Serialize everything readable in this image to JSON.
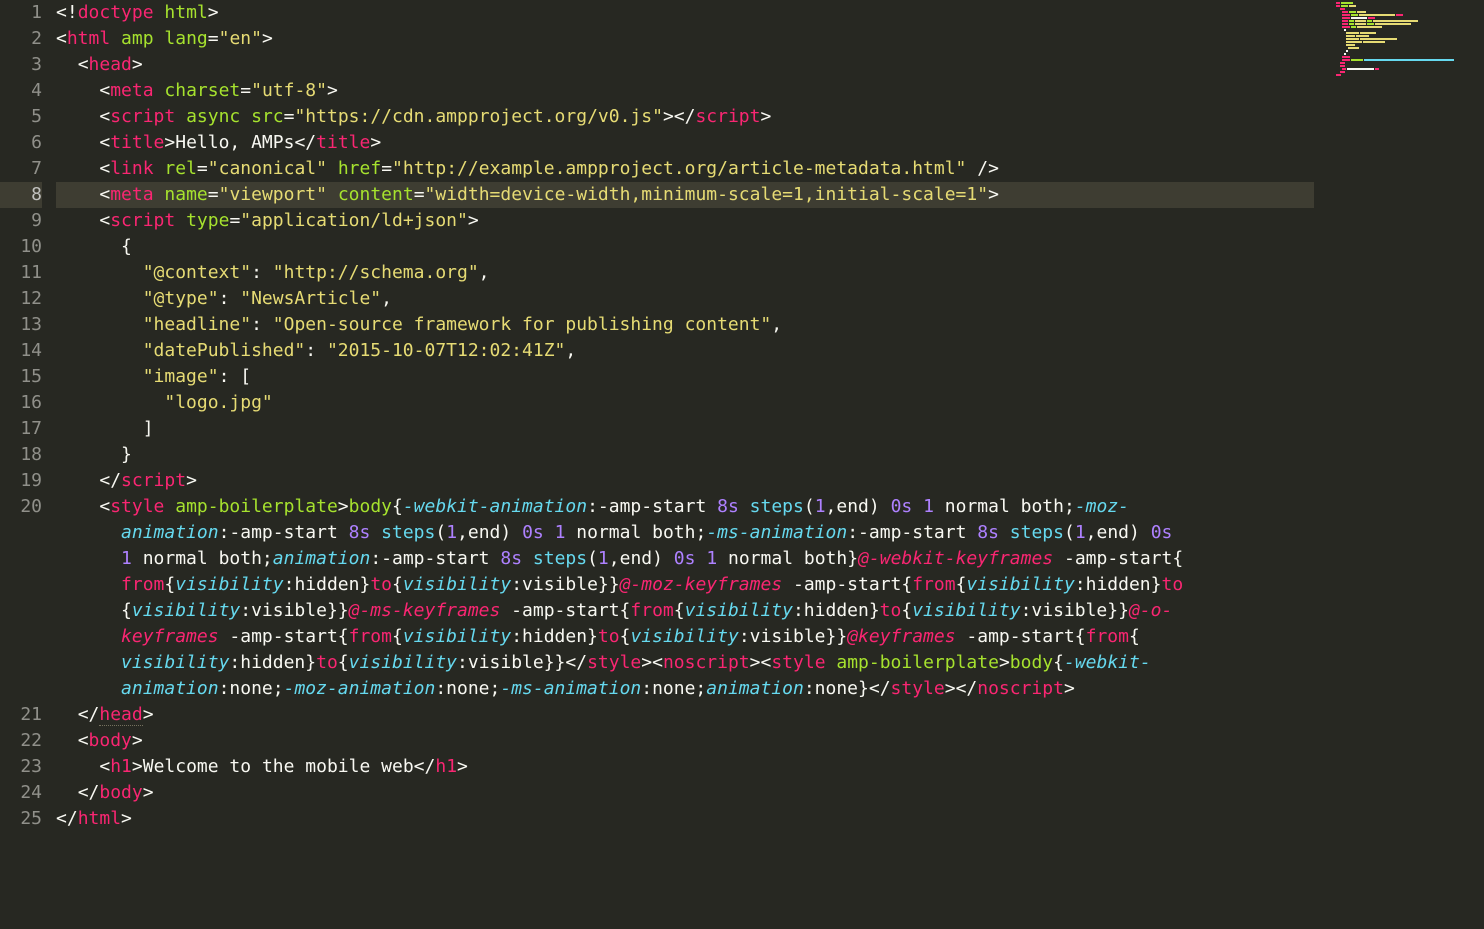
{
  "language": "html",
  "theme": "monokai",
  "current_line_number": 8,
  "line_numbers": [
    "1",
    "2",
    "3",
    "4",
    "5",
    "6",
    "7",
    "8",
    "9",
    "10",
    "11",
    "12",
    "13",
    "14",
    "15",
    "16",
    "17",
    "18",
    "19",
    "20",
    "21",
    "22",
    "23",
    "24",
    "25"
  ],
  "lines": {
    "1": {
      "indent": "",
      "tokens": [
        [
          "bracket",
          "<!"
        ],
        [
          "doctype",
          "doctype"
        ],
        [
          "txt",
          " "
        ],
        [
          "attr",
          "html"
        ],
        [
          "bracket",
          ">"
        ]
      ]
    },
    "2": {
      "indent": "",
      "tokens": [
        [
          "bracket",
          "<"
        ],
        [
          "tag",
          "html"
        ],
        [
          "txt",
          " "
        ],
        [
          "attr",
          "amp"
        ],
        [
          "txt",
          " "
        ],
        [
          "attr",
          "lang"
        ],
        [
          "txt",
          "="
        ],
        [
          "str",
          "\"en\""
        ],
        [
          "bracket",
          ">"
        ]
      ]
    },
    "3": {
      "indent": "  ",
      "tokens": [
        [
          "bracket",
          "<"
        ],
        [
          "tag",
          "head"
        ],
        [
          "bracket",
          ">"
        ]
      ]
    },
    "4": {
      "indent": "    ",
      "tokens": [
        [
          "bracket",
          "<"
        ],
        [
          "tag",
          "meta"
        ],
        [
          "txt",
          " "
        ],
        [
          "attr",
          "charset"
        ],
        [
          "txt",
          "="
        ],
        [
          "str",
          "\"utf-8\""
        ],
        [
          "bracket",
          ">"
        ]
      ]
    },
    "5": {
      "indent": "    ",
      "tokens": [
        [
          "bracket",
          "<"
        ],
        [
          "tag",
          "script"
        ],
        [
          "txt",
          " "
        ],
        [
          "attr",
          "async"
        ],
        [
          "txt",
          " "
        ],
        [
          "attr",
          "src"
        ],
        [
          "txt",
          "="
        ],
        [
          "str",
          "\"https://cdn.ampproject.org/v0.js\""
        ],
        [
          "bracket",
          "></"
        ],
        [
          "tag",
          "script"
        ],
        [
          "bracket",
          ">"
        ]
      ]
    },
    "6": {
      "indent": "    ",
      "tokens": [
        [
          "bracket",
          "<"
        ],
        [
          "tag",
          "title"
        ],
        [
          "bracket",
          ">"
        ],
        [
          "txt",
          "Hello, AMPs"
        ],
        [
          "bracket",
          "</"
        ],
        [
          "tag",
          "title"
        ],
        [
          "bracket",
          ">"
        ]
      ]
    },
    "7": {
      "indent": "    ",
      "tokens": [
        [
          "bracket",
          "<"
        ],
        [
          "tag",
          "link"
        ],
        [
          "txt",
          " "
        ],
        [
          "attr",
          "rel"
        ],
        [
          "txt",
          "="
        ],
        [
          "str",
          "\"canonical\""
        ],
        [
          "txt",
          " "
        ],
        [
          "attr",
          "href"
        ],
        [
          "txt",
          "="
        ],
        [
          "str",
          "\"http://example.ampproject.org/article-metadata.html\""
        ],
        [
          "txt",
          " "
        ],
        [
          "bracket",
          "/>"
        ]
      ]
    },
    "8": {
      "indent": "    ",
      "tokens": [
        [
          "bracket",
          "<"
        ],
        [
          "tag",
          "meta"
        ],
        [
          "txt",
          " "
        ],
        [
          "attr",
          "name"
        ],
        [
          "txt",
          "="
        ],
        [
          "str",
          "\"viewport\""
        ],
        [
          "txt",
          " "
        ],
        [
          "attr",
          "content"
        ],
        [
          "txt",
          "="
        ],
        [
          "str",
          "\"width=device-width,minimum-scale=1,initial-scale=1\""
        ],
        [
          "bracket",
          ">"
        ]
      ]
    },
    "9": {
      "indent": "    ",
      "tokens": [
        [
          "bracket",
          "<"
        ],
        [
          "tag",
          "script"
        ],
        [
          "txt",
          " "
        ],
        [
          "attr",
          "type"
        ],
        [
          "txt",
          "="
        ],
        [
          "str",
          "\"application/ld+json\""
        ],
        [
          "bracket",
          ">"
        ]
      ]
    },
    "10": {
      "indent": "      ",
      "tokens": [
        [
          "txt",
          "{"
        ]
      ]
    },
    "11": {
      "indent": "        ",
      "tokens": [
        [
          "str",
          "\"@context\""
        ],
        [
          "txt",
          ": "
        ],
        [
          "str",
          "\"http://schema.org\""
        ],
        [
          "txt",
          ","
        ]
      ]
    },
    "12": {
      "indent": "        ",
      "tokens": [
        [
          "str",
          "\"@type\""
        ],
        [
          "txt",
          ": "
        ],
        [
          "str",
          "\"NewsArticle\""
        ],
        [
          "txt",
          ","
        ]
      ]
    },
    "13": {
      "indent": "        ",
      "tokens": [
        [
          "str",
          "\"headline\""
        ],
        [
          "txt",
          ": "
        ],
        [
          "str",
          "\"Open-source framework for publishing content\""
        ],
        [
          "txt",
          ","
        ]
      ]
    },
    "14": {
      "indent": "        ",
      "tokens": [
        [
          "str",
          "\"datePublished\""
        ],
        [
          "txt",
          ": "
        ],
        [
          "str",
          "\"2015-10-07T12:02:41Z\""
        ],
        [
          "txt",
          ","
        ]
      ]
    },
    "15": {
      "indent": "        ",
      "tokens": [
        [
          "str",
          "\"image\""
        ],
        [
          "txt",
          ": ["
        ]
      ]
    },
    "16": {
      "indent": "          ",
      "tokens": [
        [
          "str",
          "\"logo.jpg\""
        ]
      ]
    },
    "17": {
      "indent": "        ",
      "tokens": [
        [
          "txt",
          "]"
        ]
      ]
    },
    "18": {
      "indent": "      ",
      "tokens": [
        [
          "txt",
          "}"
        ]
      ]
    },
    "19": {
      "indent": "    ",
      "tokens": [
        [
          "bracket",
          "</"
        ],
        [
          "tag",
          "script"
        ],
        [
          "bracket",
          ">"
        ]
      ]
    },
    "21": {
      "indent": "  ",
      "tokens": [
        [
          "bracket",
          "</"
        ],
        [
          "tag",
          "head"
        ],
        [
          "bracket",
          ">"
        ]
      ],
      "dotted": [
        "head"
      ]
    },
    "22": {
      "indent": "  ",
      "tokens": [
        [
          "bracket",
          "<"
        ],
        [
          "tag",
          "body"
        ],
        [
          "bracket",
          ">"
        ]
      ]
    },
    "23": {
      "indent": "    ",
      "tokens": [
        [
          "bracket",
          "<"
        ],
        [
          "tag",
          "h1"
        ],
        [
          "bracket",
          ">"
        ],
        [
          "txt",
          "Welcome to the mobile web"
        ],
        [
          "bracket",
          "</"
        ],
        [
          "tag",
          "h1"
        ],
        [
          "bracket",
          ">"
        ]
      ]
    },
    "24": {
      "indent": "  ",
      "tokens": [
        [
          "bracket",
          "</"
        ],
        [
          "tag",
          "body"
        ],
        [
          "bracket",
          ">"
        ]
      ]
    },
    "25": {
      "indent": "",
      "tokens": [
        [
          "bracket",
          "</"
        ],
        [
          "tag",
          "html"
        ],
        [
          "bracket",
          ">"
        ]
      ]
    }
  },
  "line20": {
    "indent": "    ",
    "first": [
      [
        "bracket",
        "<"
      ],
      [
        "tag",
        "style"
      ],
      [
        "txt",
        " "
      ],
      [
        "attr",
        "amp-boilerplate"
      ],
      [
        "bracket",
        ">"
      ],
      [
        "sel",
        "body"
      ],
      [
        "txt",
        "{"
      ],
      [
        "prop",
        "-webkit-animation"
      ],
      [
        "txt",
        ":-amp-start "
      ],
      [
        "num",
        "8s"
      ],
      [
        "txt",
        " "
      ],
      [
        "fn",
        "steps"
      ],
      [
        "txt",
        "("
      ],
      [
        "num",
        "1"
      ],
      [
        "txt",
        ",end) "
      ],
      [
        "num",
        "0s"
      ],
      [
        "txt",
        " "
      ],
      [
        "num",
        "1"
      ],
      [
        "txt",
        " normal both;"
      ],
      [
        "prop",
        "-moz-"
      ]
    ],
    "cont": [
      [
        [
          "prop",
          "animation"
        ],
        [
          "txt",
          ":-amp-start "
        ],
        [
          "num",
          "8s"
        ],
        [
          "txt",
          " "
        ],
        [
          "fn",
          "steps"
        ],
        [
          "txt",
          "("
        ],
        [
          "num",
          "1"
        ],
        [
          "txt",
          ",end) "
        ],
        [
          "num",
          "0s"
        ],
        [
          "txt",
          " "
        ],
        [
          "num",
          "1"
        ],
        [
          "txt",
          " normal both;"
        ],
        [
          "prop",
          "-ms-animation"
        ],
        [
          "txt",
          ":-amp-start "
        ],
        [
          "num",
          "8s"
        ],
        [
          "txt",
          " "
        ],
        [
          "fn",
          "steps"
        ],
        [
          "txt",
          "("
        ],
        [
          "num",
          "1"
        ],
        [
          "txt",
          ",end) "
        ],
        [
          "num",
          "0s"
        ],
        [
          "txt",
          " "
        ]
      ],
      [
        [
          "num",
          "1"
        ],
        [
          "txt",
          " normal both;"
        ],
        [
          "prop",
          "animation"
        ],
        [
          "txt",
          ":-amp-start "
        ],
        [
          "num",
          "8s"
        ],
        [
          "txt",
          " "
        ],
        [
          "fn",
          "steps"
        ],
        [
          "txt",
          "("
        ],
        [
          "num",
          "1"
        ],
        [
          "txt",
          ",end) "
        ],
        [
          "num",
          "0s"
        ],
        [
          "txt",
          " "
        ],
        [
          "num",
          "1"
        ],
        [
          "txt",
          " normal both}"
        ],
        [
          "at",
          "@-webkit-keyframes"
        ],
        [
          "txt",
          " -amp-start{"
        ]
      ],
      [
        [
          "kw",
          "from"
        ],
        [
          "txt",
          "{"
        ],
        [
          "prop",
          "visibility"
        ],
        [
          "txt",
          ":hidden}"
        ],
        [
          "kw",
          "to"
        ],
        [
          "txt",
          "{"
        ],
        [
          "prop",
          "visibility"
        ],
        [
          "txt",
          ":visible}}"
        ],
        [
          "at",
          "@-moz-keyframes"
        ],
        [
          "txt",
          " -amp-start{"
        ],
        [
          "kw",
          "from"
        ],
        [
          "txt",
          "{"
        ],
        [
          "prop",
          "visibility"
        ],
        [
          "txt",
          ":hidden}"
        ],
        [
          "kw",
          "to"
        ]
      ],
      [
        [
          "txt",
          "{"
        ],
        [
          "prop",
          "visibility"
        ],
        [
          "txt",
          ":visible}}"
        ],
        [
          "at",
          "@-ms-keyframes"
        ],
        [
          "txt",
          " -amp-start{"
        ],
        [
          "kw",
          "from"
        ],
        [
          "txt",
          "{"
        ],
        [
          "prop",
          "visibility"
        ],
        [
          "txt",
          ":hidden}"
        ],
        [
          "kw",
          "to"
        ],
        [
          "txt",
          "{"
        ],
        [
          "prop",
          "visibility"
        ],
        [
          "txt",
          ":visible}}"
        ],
        [
          "at",
          "@-o-"
        ]
      ],
      [
        [
          "at",
          "keyframes"
        ],
        [
          "txt",
          " -amp-start{"
        ],
        [
          "kw",
          "from"
        ],
        [
          "txt",
          "{"
        ],
        [
          "prop",
          "visibility"
        ],
        [
          "txt",
          ":hidden}"
        ],
        [
          "kw",
          "to"
        ],
        [
          "txt",
          "{"
        ],
        [
          "prop",
          "visibility"
        ],
        [
          "txt",
          ":visible}}"
        ],
        [
          "at",
          "@keyframes"
        ],
        [
          "txt",
          " -amp-start{"
        ],
        [
          "kw",
          "from"
        ],
        [
          "txt",
          "{"
        ]
      ],
      [
        [
          "prop",
          "visibility"
        ],
        [
          "txt",
          ":hidden}"
        ],
        [
          "kw",
          "to"
        ],
        [
          "txt",
          "{"
        ],
        [
          "prop",
          "visibility"
        ],
        [
          "txt",
          ":visible}}"
        ],
        [
          "bracket",
          "</"
        ],
        [
          "tag",
          "style"
        ],
        [
          "bracket",
          "><"
        ],
        [
          "tag",
          "noscript"
        ],
        [
          "bracket",
          "><"
        ],
        [
          "tag",
          "style"
        ],
        [
          "txt",
          " "
        ],
        [
          "attr",
          "amp-boilerplate"
        ],
        [
          "bracket",
          ">"
        ],
        [
          "sel",
          "body"
        ],
        [
          "txt",
          "{"
        ],
        [
          "prop",
          "-webkit-"
        ]
      ],
      [
        [
          "prop",
          "animation"
        ],
        [
          "txt",
          ":none;"
        ],
        [
          "prop",
          "-moz-animation"
        ],
        [
          "txt",
          ":none;"
        ],
        [
          "prop",
          "-ms-animation"
        ],
        [
          "txt",
          ":none;"
        ],
        [
          "prop",
          "animation"
        ],
        [
          "txt",
          ":none}"
        ],
        [
          "bracket",
          "</"
        ],
        [
          "tag",
          "style"
        ],
        [
          "bracket",
          "></"
        ],
        [
          "tag",
          "noscript"
        ],
        [
          "bracket",
          ">"
        ]
      ]
    ]
  },
  "minimap_lines": [
    [
      [
        4,
        "#f92672"
      ],
      [
        14,
        "#a6e22e"
      ]
    ],
    [
      [
        4,
        "#f92672"
      ],
      [
        8,
        "#a6e22e"
      ],
      [
        8,
        "#e6db74"
      ]
    ],
    [
      [
        3,
        ""
      ],
      [
        6,
        "#f92672"
      ]
    ],
    [
      [
        6,
        ""
      ],
      [
        6,
        "#f92672"
      ],
      [
        8,
        "#a6e22e"
      ],
      [
        10,
        "#e6db74"
      ]
    ],
    [
      [
        6,
        ""
      ],
      [
        8,
        "#f92672"
      ],
      [
        8,
        "#a6e22e"
      ],
      [
        40,
        "#e6db74"
      ],
      [
        8,
        "#f92672"
      ]
    ],
    [
      [
        6,
        ""
      ],
      [
        8,
        "#f92672"
      ],
      [
        18,
        "#f8f8f2"
      ],
      [
        8,
        "#f92672"
      ]
    ],
    [
      [
        6,
        ""
      ],
      [
        6,
        "#f92672"
      ],
      [
        6,
        "#a6e22e"
      ],
      [
        12,
        "#e6db74"
      ],
      [
        6,
        "#a6e22e"
      ],
      [
        50,
        "#e6db74"
      ]
    ],
    [
      [
        6,
        ""
      ],
      [
        6,
        "#f92672"
      ],
      [
        6,
        "#a6e22e"
      ],
      [
        12,
        "#e6db74"
      ],
      [
        8,
        "#a6e22e"
      ],
      [
        40,
        "#e6db74"
      ]
    ],
    [
      [
        6,
        ""
      ],
      [
        8,
        "#f92672"
      ],
      [
        6,
        "#a6e22e"
      ],
      [
        28,
        "#e6db74"
      ]
    ],
    [
      [
        8,
        ""
      ],
      [
        2,
        "#f8f8f2"
      ]
    ],
    [
      [
        10,
        ""
      ],
      [
        14,
        "#e6db74"
      ],
      [
        18,
        "#e6db74"
      ]
    ],
    [
      [
        10,
        ""
      ],
      [
        10,
        "#e6db74"
      ],
      [
        14,
        "#e6db74"
      ]
    ],
    [
      [
        10,
        ""
      ],
      [
        14,
        "#e6db74"
      ],
      [
        42,
        "#e6db74"
      ]
    ],
    [
      [
        10,
        ""
      ],
      [
        18,
        "#e6db74"
      ],
      [
        24,
        "#e6db74"
      ]
    ],
    [
      [
        10,
        ""
      ],
      [
        10,
        "#e6db74"
      ]
    ],
    [
      [
        12,
        ""
      ],
      [
        12,
        "#e6db74"
      ]
    ],
    [
      [
        10,
        ""
      ],
      [
        2,
        "#f8f8f2"
      ]
    ],
    [
      [
        8,
        ""
      ],
      [
        2,
        "#f8f8f2"
      ]
    ],
    [
      [
        6,
        ""
      ],
      [
        8,
        "#f92672"
      ]
    ],
    [
      [
        6,
        ""
      ],
      [
        8,
        "#f92672"
      ],
      [
        14,
        "#a6e22e"
      ],
      [
        100,
        "#66d9ef"
      ]
    ],
    [
      [
        3,
        ""
      ],
      [
        6,
        "#f92672"
      ]
    ],
    [
      [
        3,
        ""
      ],
      [
        6,
        "#f92672"
      ]
    ],
    [
      [
        6,
        ""
      ],
      [
        4,
        "#f92672"
      ],
      [
        30,
        "#f8f8f2"
      ],
      [
        4,
        "#f92672"
      ]
    ],
    [
      [
        3,
        ""
      ],
      [
        6,
        "#f92672"
      ]
    ],
    [
      [
        6,
        "#f92672"
      ]
    ]
  ]
}
